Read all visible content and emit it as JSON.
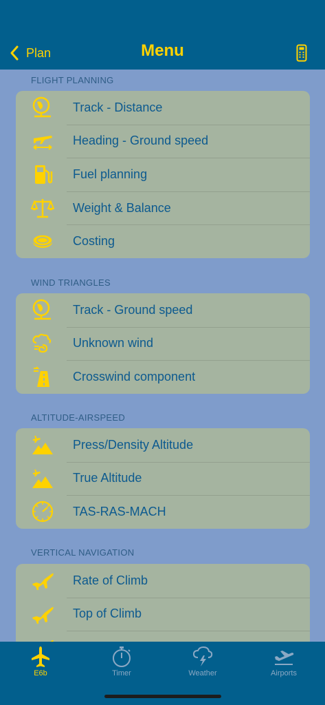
{
  "header": {
    "back_label": "Plan",
    "title": "Menu"
  },
  "sections": [
    {
      "title": "FLIGHT PLANNING",
      "items": [
        {
          "label": "Track - Distance",
          "icon": "globe-track-icon"
        },
        {
          "label": "Heading - Ground speed",
          "icon": "plane-heading-icon"
        },
        {
          "label": "Fuel planning",
          "icon": "fuel-pump-icon"
        },
        {
          "label": "Weight & Balance",
          "icon": "balance-scale-icon"
        },
        {
          "label": "Costing",
          "icon": "coins-icon"
        }
      ]
    },
    {
      "title": "WIND TRIANGLES",
      "items": [
        {
          "label": "Track - Ground speed",
          "icon": "globe-track-icon"
        },
        {
          "label": "Unknown wind",
          "icon": "wind-cloud-icon"
        },
        {
          "label": "Crosswind component",
          "icon": "runway-crosswind-icon"
        }
      ]
    },
    {
      "title": "ALTITUDE-AIRSPEED",
      "items": [
        {
          "label": "Press/Density Altitude",
          "icon": "plane-mountain-icon"
        },
        {
          "label": "True Altitude",
          "icon": "plane-mountain-icon"
        },
        {
          "label": "TAS-RAS-MACH",
          "icon": "airspeed-gauge-icon"
        }
      ]
    },
    {
      "title": "VERTICAL NAVIGATION",
      "items": [
        {
          "label": "Rate of Climb",
          "icon": "airplane-icon"
        },
        {
          "label": "Top of Climb",
          "icon": "airplane-icon"
        },
        {
          "label": "",
          "icon": "airplane-icon"
        }
      ]
    }
  ],
  "tabs": [
    {
      "label": "E6b",
      "icon": "airplane-icon",
      "active": true
    },
    {
      "label": "Timer",
      "icon": "stopwatch-icon",
      "active": false
    },
    {
      "label": "Weather",
      "icon": "thunderstorm-icon",
      "active": false
    },
    {
      "label": "Airports",
      "icon": "departure-icon",
      "active": false
    }
  ],
  "colors": {
    "accent": "#ffd200",
    "bar": "#025f8d",
    "background": "#7f9ccb",
    "group": "#a5b4a0",
    "text": "#0d5a8f"
  }
}
